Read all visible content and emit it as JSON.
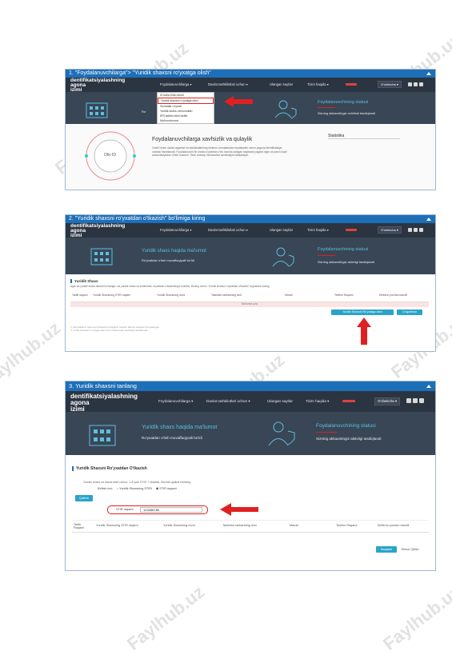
{
  "section1": {
    "title": "1. \"Foydalanuvchilarga\"> \"Yuridik shaxsni ro'yxatga olish\"",
    "logo": [
      "dentifikatsiyalashning",
      "agona",
      "izimi"
    ],
    "menu": [
      "Foydalanuvchilarga ▾",
      "Davlat tashkilotlari uchun ▾",
      "Ulangan saytlar",
      "Tizim haqida ▾"
    ],
    "lang": "O'zbekcha ▾",
    "dropdown": [
      "ID karta bilan kirish",
      "Yuridik shaxsni ro'yxatga olish",
      "Xizmatlar ro'yxati",
      "Yuridik shaxs ma'lumotlari",
      "ERI kalitini olish tartibi",
      "Ma'lumotnoma"
    ],
    "status_title": "Foydalanuvchining statusi",
    "status_sub": "Sizning akkauntingiz ochilishi tasdiqlandi",
    "circle_label": "Oliv ID",
    "security_title": "Foydalanuvchilarga xavfsizlik va qulaylik",
    "security_text": "OneID tizimi davlat organlari va tashkilotlarining elektron xizmatlaridan foydalanish uchun yagona identifikatsiya vositasi hisoblanadi. Foydalanuvchi bir marta ro'yxatdan o'tib, barcha ulangan saytlarda yagona login va parol orqali avtorizatsiyadan o'tishi mumkin. Tizim shaxsiy ma'lumotlar xavfsizligini kafolatlaydi.",
    "sidebar_title": "Statistika"
  },
  "section2": {
    "title": "2. \"Yuridik shaxsni ro'yxatdan o'tkazish\" bo'limiga kiring",
    "logo": [
      "dentifikatsiyalashning",
      "agona",
      "izimi"
    ],
    "menu": [
      "Foydalanuvchilarga ▾",
      "Davlat tashkilotlari uchun ▾",
      "Ulangan saytlar",
      "Tizim haqida ▾"
    ],
    "lang": "O'zbekcha ▾",
    "hero_title": "Yuridik shaxs haqida ma'lumot",
    "hero_sub": "Ro'yxatdan o'tish muvaffaqiyatli bo'ldi",
    "status_title": "Foydalanuvchining statusi",
    "status_sub": "Sizning akkauntingiz aktivligi tasdiqlandi",
    "panel_title": "Yuridik Shaxs",
    "panel_text": "Agar siz yuridik shaxs rahbari bo'lsangiz, siz yuridik shaxs va xodimlarini ro'yxatdan o'tkazishingiz mumkin. Buning uchun \"Yuridik shaxsni ro'yxatdan o'tkazish\" tugmasini bosing.",
    "columns": [
      "Tartib raqami",
      "Yuridik Shaxsning STIR raqami",
      "Yuridik Shaxsning nomi",
      "Tashkilot rahbarining ismi",
      "Manzil",
      "Telefon Raqami",
      "Elektron pochta manzili"
    ],
    "empty_text": "Ma'lumot yo'q",
    "btn_register": "Yuridik Shaxsni Ro'yxatga olish",
    "btn_refresh": "O'zgartirish",
    "footer": [
      "© 2019 Elektron hukumat loyihalarini boshqarish markazi. Barcha huquqlar himoyalangan.",
      "© Yuridik shaxslarni ro'yxatga olish tizimi | Ma'lumotlar xavfsizligi kafolatlanadi"
    ]
  },
  "section3": {
    "title": "3. Yuridik shaxsni tanlang",
    "logo": [
      "dentifikatsiyalashning",
      "agona",
      "izimi"
    ],
    "menu": [
      "Foydalanuvchilarga ▾",
      "Davlat tashkilotlari uchun ▾",
      "Ulangan saytlar",
      "Tizim haqida ▾"
    ],
    "lang": "O'zbekcha ▾",
    "hero_title": "Yuridik shaxs haqida ma'lumot",
    "hero_sub": "Ro'yxatdan o'tish muvaffaqiyatli bo'ldi",
    "status_title": "Foydalanuvchining statusi",
    "status_sub": "Sizning akkauntingiz aktivligi tasdiqlandi",
    "panel_title": "Yuridik Shaxsni Ro'yxatdan O'tkazish",
    "instruction": "Yuridik shaxs va hamd etish uchun, 1-8 yoki STIR + shtatda, Sinlinib qadiral berilang",
    "choice_label": "Kiritish turi:",
    "radio1": "Yuridik Shaxsning STIRi",
    "radio2": "STIR raqami",
    "btn_search": "Qidirish",
    "stir_label": "STIR raqami:",
    "stir_value": "123456789",
    "columns": [
      "Tartib Raqami",
      "Yuridik Shaxsning STIR raqami",
      "Yuridik Shaxsning nomi",
      "Tashkilot rahbarining ismi",
      "Manzil",
      "Telefon Raqami",
      "Elektron pochta manzili"
    ],
    "btn_save": "Saqlash",
    "btn_cancel": "Bekor Qilish"
  },
  "watermark": "Faylhub.uz",
  "colors": {
    "title_bar": "#1d6fb8",
    "navbar": "#2b3441",
    "hero": "#394656",
    "accent": "#2aa3c9",
    "arrow": "#e02020"
  }
}
